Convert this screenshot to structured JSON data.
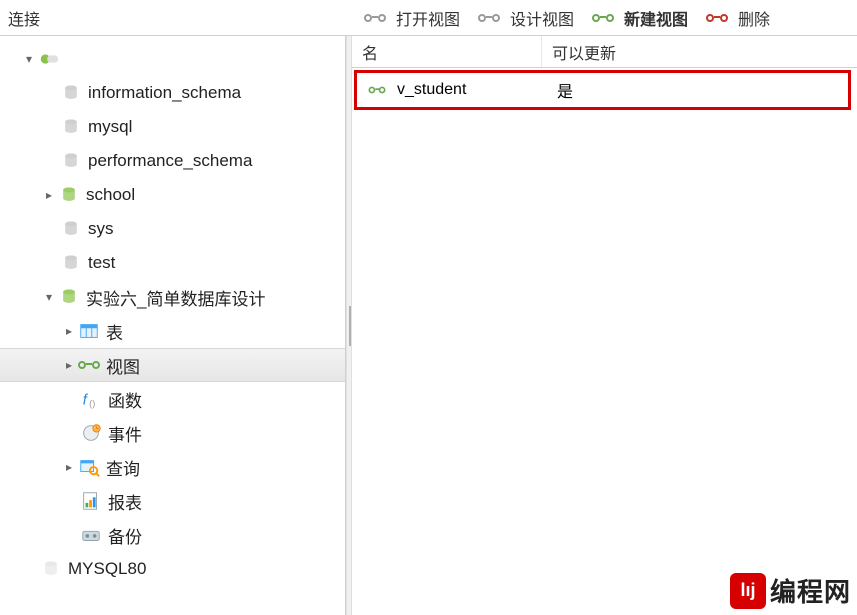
{
  "header": {
    "title": "连接"
  },
  "toolbar": {
    "open": "打开视图",
    "design": "设计视图",
    "new": "新建视图",
    "delete": "删除"
  },
  "tree": {
    "connection": "",
    "dbs": {
      "information_schema": "information_schema",
      "mysql": "mysql",
      "performance_schema": "performance_schema",
      "school": "school",
      "sys": "sys",
      "test": "test",
      "exp6": "实验六_简单数据库设计"
    },
    "nodes": {
      "tables": "表",
      "views": "视图",
      "functions": "函数",
      "events": "事件",
      "queries": "查询",
      "reports": "报表",
      "backup": "备份"
    },
    "mysql80": "MYSQL80"
  },
  "grid": {
    "col_name": "名",
    "col_updatable": "可以更新",
    "row": {
      "name": "v_student",
      "updatable": "是"
    }
  },
  "watermark": {
    "badge": "lıj",
    "text": "编程网"
  }
}
